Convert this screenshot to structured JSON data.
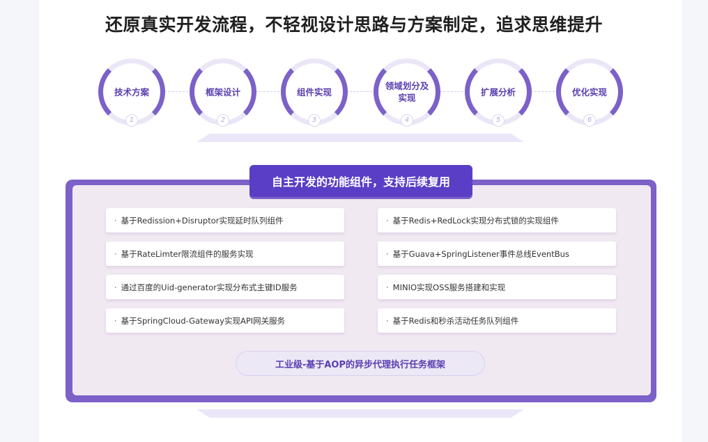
{
  "headline": "还原真实开发流程，不轻视设计思路与方案制定，追求思维提升",
  "steps": [
    {
      "label": "技术方案",
      "num": "1"
    },
    {
      "label": "框架设计",
      "num": "2"
    },
    {
      "label": "组件实现",
      "num": "3"
    },
    {
      "label": "领域划分及实现",
      "num": "4"
    },
    {
      "label": "扩展分析",
      "num": "5"
    },
    {
      "label": "优化实现",
      "num": "6"
    }
  ],
  "panel": {
    "title": "自主开发的功能组件，支持后续复用",
    "bullet": "·",
    "features": [
      "基于Redission+Disruptor实现延时队列组件",
      "基于Redis+RedLock实现分布式锁的实现组件",
      "基于RateLimter限流组件的服务实现",
      "基于Guava+SpringListener事件总线EventBus",
      "通过百度的Uid-generator实现分布式主键ID服务",
      "MINIO实现OSS服务搭建和实现",
      "基于SpringCloud-Gateway实现API网关服务",
      "基于Redis和秒杀活动任务队列组件"
    ],
    "framework": "工业级-基于AOP的异步代理执行任务框架"
  },
  "colors": {
    "accent": "#7b61c8",
    "title_bg": "#5a3ec6",
    "panel_bg": "#f1e9f2",
    "ring_track": "#ebe6f7"
  }
}
